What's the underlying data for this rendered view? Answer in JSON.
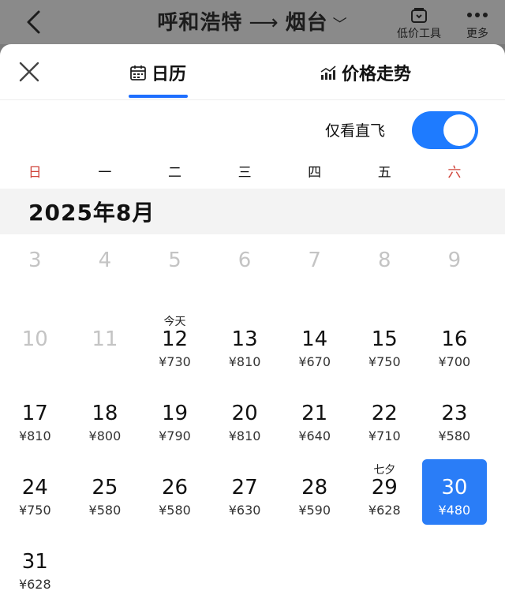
{
  "header": {
    "origin": "呼和浩特",
    "arrow": "⟶",
    "destination": "烟台",
    "low_price_tool": "低价工具",
    "more": "更多"
  },
  "sheet": {
    "tab_calendar": "日历",
    "tab_trend": "价格走势",
    "direct_only_label": "仅看直飞",
    "direct_only_on": true,
    "month_title": "2025年8月"
  },
  "weekdays": [
    "日",
    "一",
    "二",
    "三",
    "四",
    "五",
    "六"
  ],
  "calendar": {
    "rows": [
      [
        {
          "day": "3",
          "price": "",
          "tag": "",
          "disabled": true
        },
        {
          "day": "4",
          "price": "",
          "tag": "",
          "disabled": true
        },
        {
          "day": "5",
          "price": "",
          "tag": "",
          "disabled": true
        },
        {
          "day": "6",
          "price": "",
          "tag": "",
          "disabled": true
        },
        {
          "day": "7",
          "price": "",
          "tag": "",
          "disabled": true
        },
        {
          "day": "8",
          "price": "",
          "tag": "",
          "disabled": true
        },
        {
          "day": "9",
          "price": "",
          "tag": "",
          "disabled": true
        }
      ],
      [
        {
          "day": "10",
          "price": "",
          "tag": "",
          "disabled": true
        },
        {
          "day": "11",
          "price": "",
          "tag": "",
          "disabled": true
        },
        {
          "day": "12",
          "price": "¥730",
          "tag": "今天"
        },
        {
          "day": "13",
          "price": "¥810",
          "tag": ""
        },
        {
          "day": "14",
          "price": "¥670",
          "tag": ""
        },
        {
          "day": "15",
          "price": "¥750",
          "tag": ""
        },
        {
          "day": "16",
          "price": "¥700",
          "tag": ""
        }
      ],
      [
        {
          "day": "17",
          "price": "¥810",
          "tag": ""
        },
        {
          "day": "18",
          "price": "¥800",
          "tag": ""
        },
        {
          "day": "19",
          "price": "¥790",
          "tag": ""
        },
        {
          "day": "20",
          "price": "¥810",
          "tag": ""
        },
        {
          "day": "21",
          "price": "¥640",
          "tag": ""
        },
        {
          "day": "22",
          "price": "¥710",
          "tag": ""
        },
        {
          "day": "23",
          "price": "¥580",
          "tag": ""
        }
      ],
      [
        {
          "day": "24",
          "price": "¥750",
          "tag": ""
        },
        {
          "day": "25",
          "price": "¥580",
          "tag": ""
        },
        {
          "day": "26",
          "price": "¥580",
          "tag": ""
        },
        {
          "day": "27",
          "price": "¥630",
          "tag": ""
        },
        {
          "day": "28",
          "price": "¥590",
          "tag": ""
        },
        {
          "day": "29",
          "price": "¥628",
          "tag": "七夕"
        },
        {
          "day": "30",
          "price": "¥480",
          "tag": "",
          "selected": true
        }
      ],
      [
        {
          "day": "31",
          "price": "¥628",
          "tag": ""
        }
      ]
    ]
  },
  "colors": {
    "accent": "#1e6fff",
    "selected_bg": "#2a7df7",
    "weekend_red": "#d0443a"
  }
}
